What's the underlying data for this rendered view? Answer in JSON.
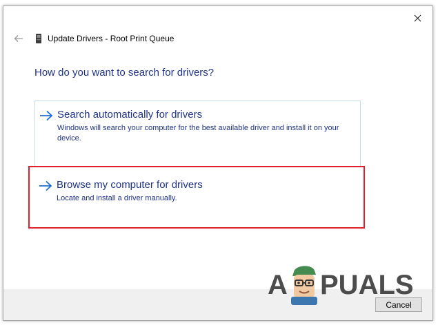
{
  "window": {
    "title": "Update Drivers - Root Print Queue",
    "close_icon": "close-icon",
    "back_icon": "back-arrow-icon",
    "device_icon": "printer-queue-icon"
  },
  "content": {
    "question": "How do you want to search for drivers?"
  },
  "options": [
    {
      "heading": "Search automatically for drivers",
      "description": "Windows will search your computer for the best available driver and install it on your device."
    },
    {
      "heading": "Browse my computer for drivers",
      "description": "Locate and install a driver manually."
    }
  ],
  "footer": {
    "cancel_label": "Cancel"
  },
  "watermark": {
    "text": "APPUALS"
  },
  "colors": {
    "link_blue": "#1e3287",
    "arrow_blue": "#1f6fd1",
    "highlight_red": "#e0202a",
    "footer_bg": "#f0f0f0"
  }
}
